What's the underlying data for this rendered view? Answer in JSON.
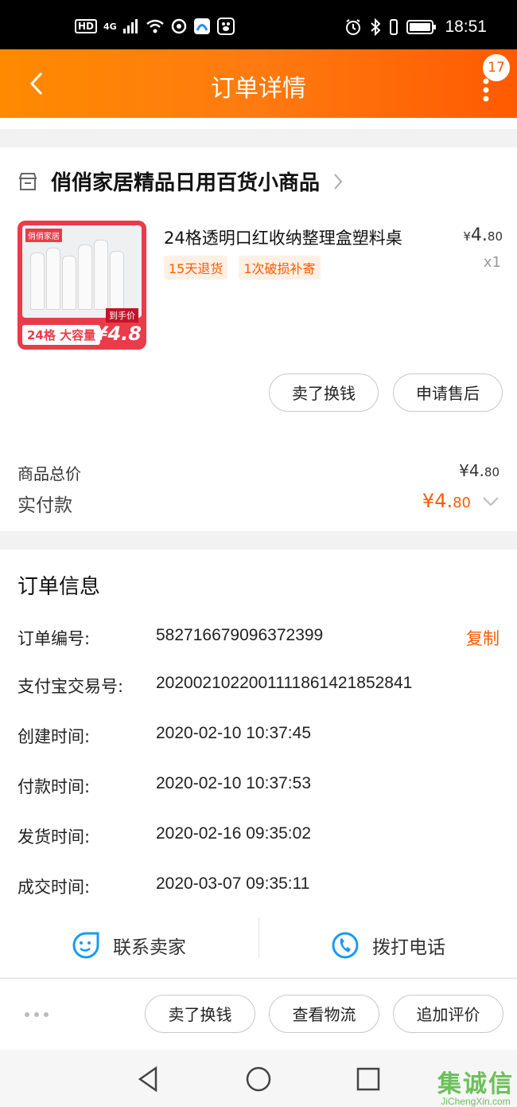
{
  "status_bar": {
    "hd": "HD",
    "network": "4G",
    "time": "18:51"
  },
  "header": {
    "title": "订单详情",
    "badge_count": "17"
  },
  "shop": {
    "name": "俏俏家居精品日用百货小商品"
  },
  "product": {
    "title": "24格透明口红收纳整理盒塑料桌",
    "tags": [
      "15天退货",
      "1次破损补寄"
    ],
    "price_symbol": "¥",
    "price_int": "4.",
    "price_dec": "80",
    "qty": "x1",
    "image": {
      "brand": "俏俏家居",
      "caption": "24格 大容量",
      "price_label": "到手价",
      "price": "¥4.8"
    }
  },
  "actions": {
    "sell_label": "卖了换钱",
    "aftersale_label": "申请售后"
  },
  "summary": {
    "goods_total_label": "商品总价",
    "goods_total_int": "¥4.",
    "goods_total_dec": "80",
    "paid_label": "实付款",
    "paid_int": "¥4.",
    "paid_dec": "80"
  },
  "order_info": {
    "section_title": "订单信息",
    "copy_label": "复制",
    "rows": [
      {
        "label": "订单编号:",
        "value": "582716679096372399"
      },
      {
        "label": "支付宝交易号:",
        "value": "2020021022001111861421852841"
      },
      {
        "label": "创建时间:",
        "value": "2020-02-10 10:37:45"
      },
      {
        "label": "付款时间:",
        "value": "2020-02-10 10:37:53"
      },
      {
        "label": "发货时间:",
        "value": "2020-02-16 09:35:02"
      },
      {
        "label": "成交时间:",
        "value": "2020-03-07 09:35:11"
      }
    ],
    "contact_seller": "联系卖家",
    "call_phone": "拨打电话"
  },
  "bottom_bar": {
    "sell_label": "卖了换钱",
    "logistics_label": "查看物流",
    "review_label": "追加评价"
  },
  "watermark": {
    "brand": "集诚信",
    "url": "JiChengXin.com"
  },
  "colors": {
    "accent": "#ff5a00",
    "header_start": "#ff8a00",
    "header_end": "#ff5a00"
  }
}
